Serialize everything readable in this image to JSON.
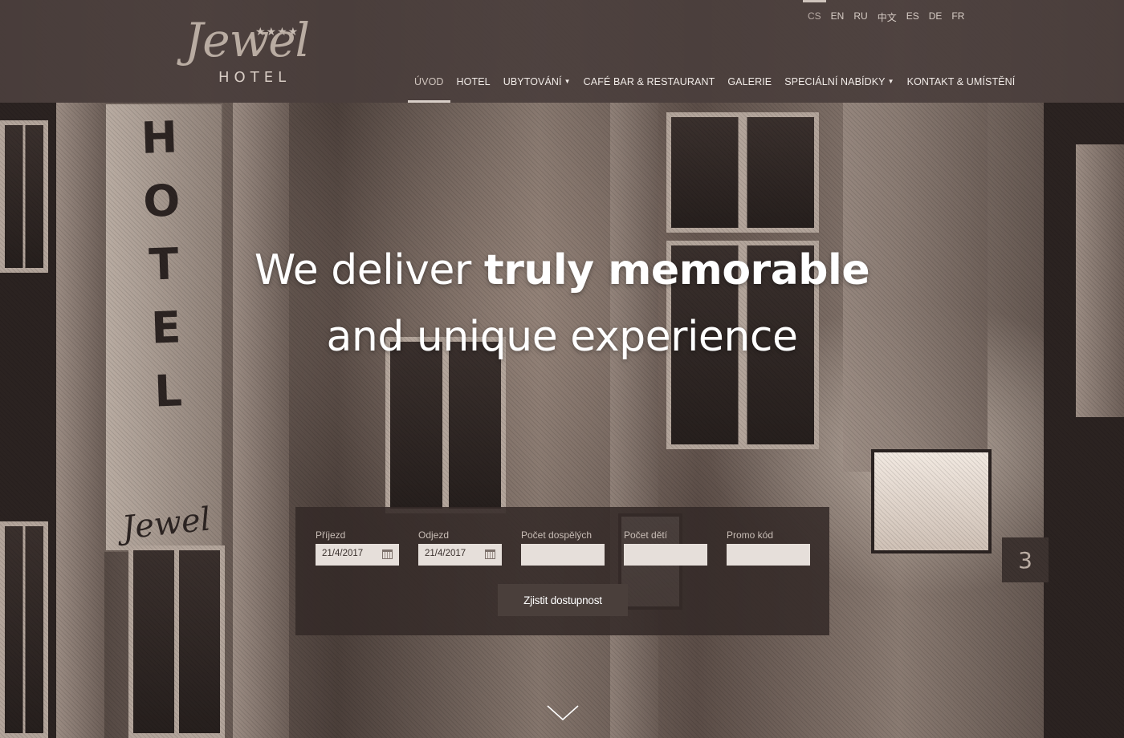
{
  "header": {
    "logo": {
      "stars": "★★★★",
      "script": "Jewel",
      "subtitle": "HOTEL"
    },
    "languages": [
      {
        "code": "CS",
        "active": true
      },
      {
        "code": "EN",
        "active": false
      },
      {
        "code": "RU",
        "active": false
      },
      {
        "code": "中文",
        "active": false
      },
      {
        "code": "ES",
        "active": false
      },
      {
        "code": "DE",
        "active": false
      },
      {
        "code": "FR",
        "active": false
      }
    ],
    "nav": [
      {
        "label": "ÚVOD",
        "active": true,
        "dropdown": false
      },
      {
        "label": "HOTEL",
        "active": false,
        "dropdown": false
      },
      {
        "label": "UBYTOVÁNÍ",
        "active": false,
        "dropdown": true
      },
      {
        "label": "CAFÉ BAR & RESTAURANT",
        "active": false,
        "dropdown": false
      },
      {
        "label": "GALERIE",
        "active": false,
        "dropdown": false
      },
      {
        "label": "SPECIÁLNÍ NABÍDKY",
        "active": false,
        "dropdown": true
      },
      {
        "label": "KONTAKT & UMÍSTĚNÍ",
        "active": false,
        "dropdown": false
      }
    ]
  },
  "hero": {
    "headline_part1": "We deliver ",
    "headline_bold": "truly memorable",
    "headline_line2": "and unique experience",
    "background_sign": {
      "letters": [
        "H",
        "O",
        "T",
        "E",
        "L"
      ],
      "script": "Jewel"
    },
    "house_number": "3"
  },
  "booking": {
    "fields": [
      {
        "label": "Příjezd",
        "value": "21/4/2017",
        "type": "date"
      },
      {
        "label": "Odjezd",
        "value": "21/4/2017",
        "type": "date"
      },
      {
        "label": "Počet dospělých",
        "value": "",
        "type": "number"
      },
      {
        "label": "Počet dětí",
        "value": "",
        "type": "number"
      },
      {
        "label": "Promo kód",
        "value": "",
        "type": "text"
      }
    ],
    "submit_label": "Zjistit dostupnost"
  },
  "icons": {
    "calendar": "calendar-icon",
    "caret": "caret-down-icon",
    "scroll": "chevron-down-icon"
  },
  "colors": {
    "header_bg": "#4a3e3c",
    "form_bg": "#342a28",
    "button_bg": "#4a3f3b",
    "input_bg": "#e6dfda"
  }
}
